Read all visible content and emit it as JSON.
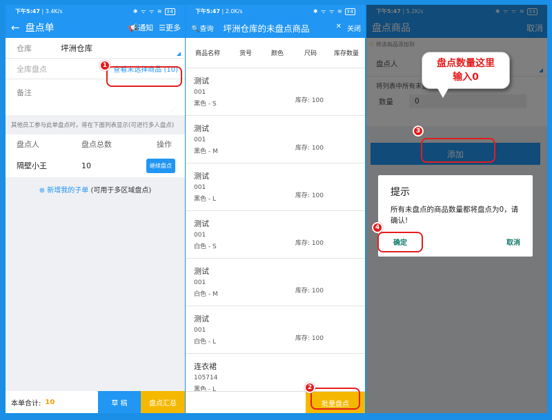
{
  "p1": {
    "status": {
      "time": "下午5:47",
      "speed": "3.4K/s",
      "signal": "✱ ᯤ ᯤ ≋",
      "battery": "34"
    },
    "title": "盘点单",
    "notify": "通知",
    "more": "更多",
    "warehouse_label": "仓库",
    "warehouse_value": "坪洲仓库",
    "full_label": "全库盘点",
    "unselected_link": "查看未选择商品 (10)",
    "note_label": "备注",
    "hint": "其他员工参与此单盘点时，将在下面列表显示(可进行多人盘点)",
    "table_headers": [
      "盘点人",
      "盘点总数",
      "操作"
    ],
    "row": {
      "name": "隔壁小王",
      "total": "10",
      "action": "继续盘点"
    },
    "add_child": "新增我的子单",
    "add_child_note": "(可用于多区域盘点)",
    "footer_label": "本单合计:",
    "footer_total": "10",
    "draft": "草 稿",
    "summary": "盘点汇总"
  },
  "p2": {
    "status": {
      "time": "下午5:47",
      "speed": "2.0K/s",
      "signal": "✱ ᯤ ᯤ ≋",
      "battery": "34"
    },
    "query": "查询",
    "title": "坪洲仓库的未盘点商品",
    "close": "关闭",
    "headers": [
      "商品名称",
      "货号",
      "颜色",
      "尺码",
      "库存数量"
    ],
    "items": [
      {
        "name": "测试",
        "code": "001",
        "variant": "黑色 - S",
        "stock": "库存: 100"
      },
      {
        "name": "测试",
        "code": "001",
        "variant": "黑色 - M",
        "stock": "库存: 100"
      },
      {
        "name": "测试",
        "code": "001",
        "variant": "黑色 - L",
        "stock": "库存: 100"
      },
      {
        "name": "测试",
        "code": "001",
        "variant": "白色 - S",
        "stock": "库存: 100"
      },
      {
        "name": "测试",
        "code": "001",
        "variant": "白色 - M",
        "stock": "库存: 100"
      },
      {
        "name": "测试",
        "code": "001",
        "variant": "白色 - L",
        "stock": "库存: 100"
      },
      {
        "name": "连衣裙",
        "code": "105714",
        "variant": "黑色 - L",
        "stock": ""
      }
    ],
    "batch": "批量盘点"
  },
  "p3": {
    "status": {
      "time": "下午5:47",
      "speed": "5.2K/s",
      "signal": "✱ ᯤ ᯤ ≋",
      "battery": "34"
    },
    "title": "盘点商品",
    "cancel_top": "取消",
    "star_hint": "将该商品添加到",
    "counter_label": "盘点人",
    "desc": "将列表中所有未盘点的商品添加到盘点单",
    "qty_label": "数量",
    "qty_value": "0",
    "add": "添加",
    "tooltip_line1": "盘点数量这里",
    "tooltip_line2": "输入0",
    "dialog": {
      "title": "提示",
      "message": "所有未盘点的商品数量都将盘点为0，请确认!",
      "confirm": "确定",
      "cancel": "取消"
    }
  },
  "steps": [
    "1",
    "2",
    "3",
    "4"
  ],
  "colors": {
    "primary": "#2196f3",
    "accent_yellow": "#f5b800",
    "callout_red": "#e41c1c",
    "dialog_green": "#0e7a6a"
  }
}
